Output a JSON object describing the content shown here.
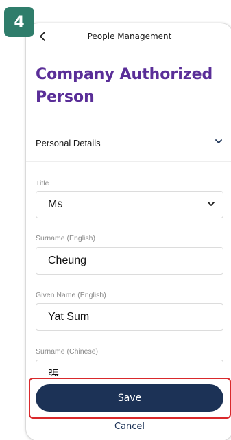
{
  "step_badge": "4",
  "header": {
    "title": "People Management",
    "back_icon": "chevron-left-icon"
  },
  "page_title": "Company Authorized Person",
  "section": {
    "label": "Personal Details",
    "icon": "chevron-down-icon"
  },
  "fields": {
    "title": {
      "label": "Title",
      "value": "Ms"
    },
    "surname_en": {
      "label": "Surname (English)",
      "value": "Cheung"
    },
    "given_name_en": {
      "label": "Given Name (English)",
      "value": "Yat Sum"
    },
    "surname_zh": {
      "label": "Surname (Chinese)",
      "value": "張"
    }
  },
  "actions": {
    "save_label": "Save",
    "cancel_label": "Cancel"
  },
  "colors": {
    "badge": "#2f7d6b",
    "title_purple": "#5a2e98",
    "primary_navy": "#1c3256",
    "highlight_red": "#d9292c"
  }
}
